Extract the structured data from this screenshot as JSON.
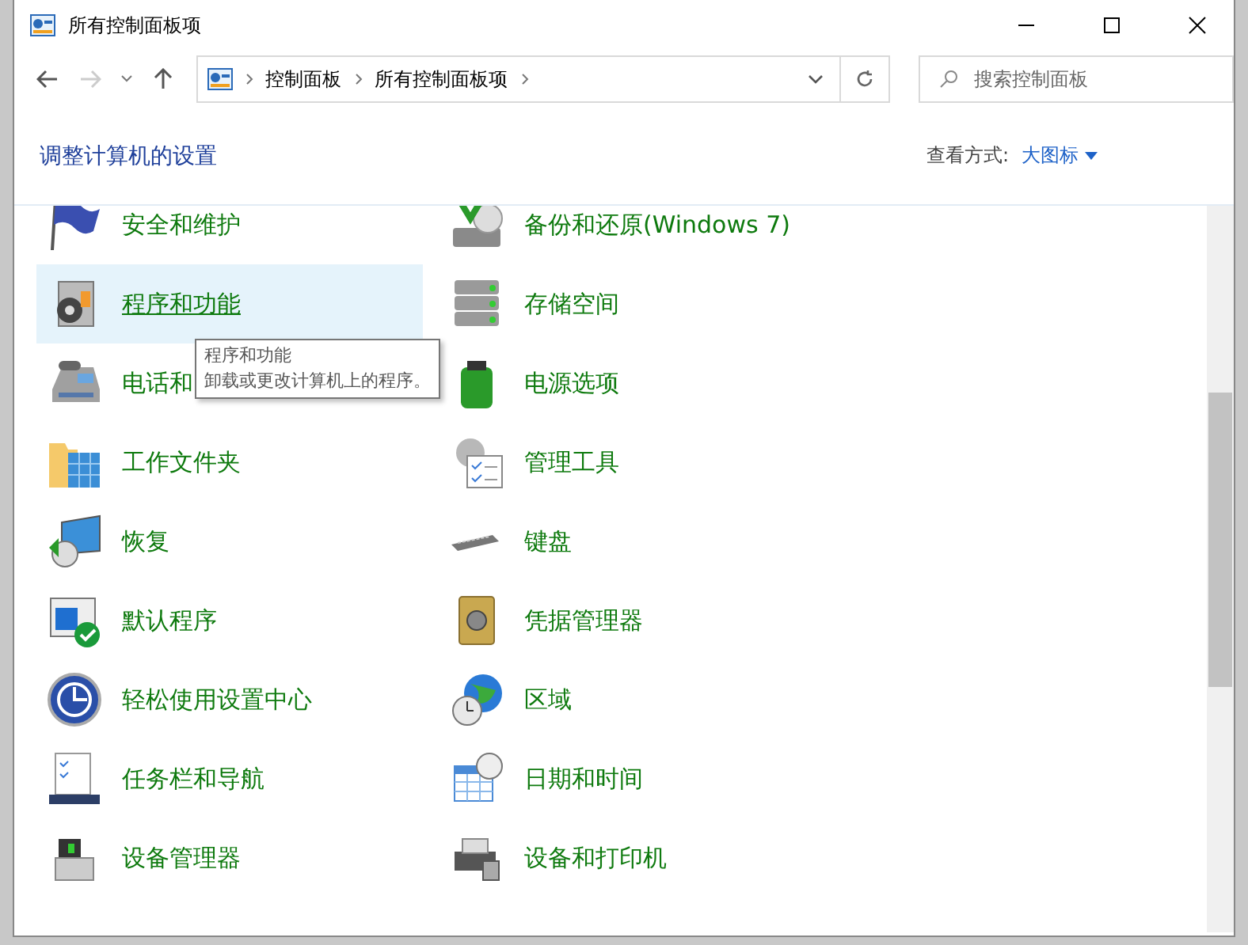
{
  "window": {
    "title": "所有控制面板项"
  },
  "address_bar": {
    "crumbs": [
      "控制面板",
      "所有控制面板项"
    ]
  },
  "search": {
    "placeholder": "搜索控制面板"
  },
  "header": {
    "title": "调整计算机的设置",
    "view_label": "查看方式:",
    "view_value": "大图标"
  },
  "items": [
    {
      "label": "安全和维护",
      "hovered": false
    },
    {
      "label": "备份和还原(Windows 7)",
      "hovered": false
    },
    {
      "label": "程序和功能",
      "hovered": true
    },
    {
      "label": "存储空间",
      "hovered": false
    },
    {
      "label": "电话和",
      "hovered": false
    },
    {
      "label": "电源选项",
      "hovered": false
    },
    {
      "label": "工作文件夹",
      "hovered": false
    },
    {
      "label": "管理工具",
      "hovered": false
    },
    {
      "label": "恢复",
      "hovered": false
    },
    {
      "label": "键盘",
      "hovered": false
    },
    {
      "label": "默认程序",
      "hovered": false
    },
    {
      "label": "凭据管理器",
      "hovered": false
    },
    {
      "label": "轻松使用设置中心",
      "hovered": false
    },
    {
      "label": "区域",
      "hovered": false
    },
    {
      "label": "任务栏和导航",
      "hovered": false
    },
    {
      "label": "日期和时间",
      "hovered": false
    },
    {
      "label": "设备管理器",
      "hovered": false
    },
    {
      "label": "设备和打印机",
      "hovered": false
    }
  ],
  "tooltip": {
    "title": "程序和功能",
    "text": "卸载或更改计算机上的程序。"
  }
}
